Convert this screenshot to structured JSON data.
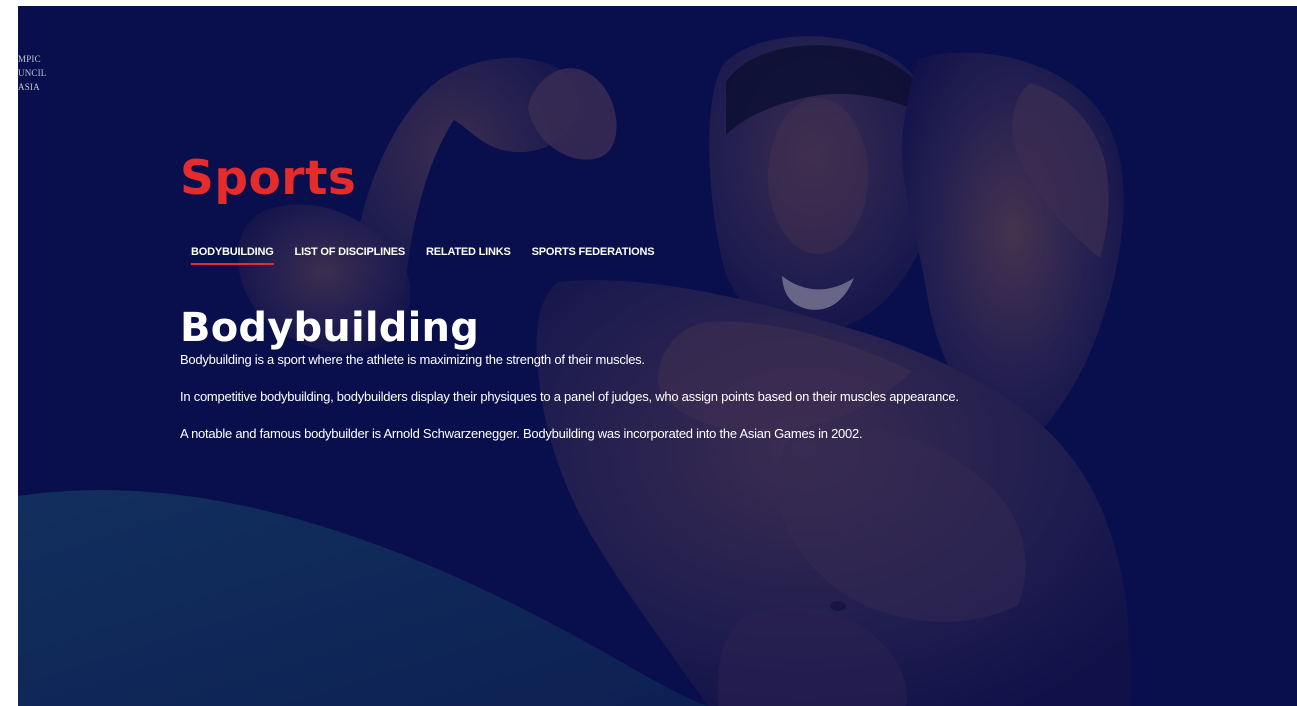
{
  "logo": {
    "text": "MPIC\nUNCIL\nASIA"
  },
  "section": {
    "title": "Sports"
  },
  "tabs": [
    {
      "label": "BODYBUILDING",
      "active": true
    },
    {
      "label": "LIST OF DISCIPLINES",
      "active": false
    },
    {
      "label": "RELATED LINKS",
      "active": false
    },
    {
      "label": "SPORTS FEDERATIONS",
      "active": false
    }
  ],
  "article": {
    "title": "Bodybuilding",
    "paragraphs": [
      "Bodybuilding is a sport where the athlete is maximizing the strength of their muscles.",
      "In competitive bodybuilding, bodybuilders display their physiques to a panel of judges, who assign points based on their muscles appearance.",
      "A notable and famous bodybuilder is Arnold Schwarzenegger. Bodybuilding was incorporated into the Asian Games in 2002."
    ]
  },
  "colors": {
    "accent": "#e52b2b",
    "background": "#0a0e4c",
    "text": "#ffffff"
  }
}
